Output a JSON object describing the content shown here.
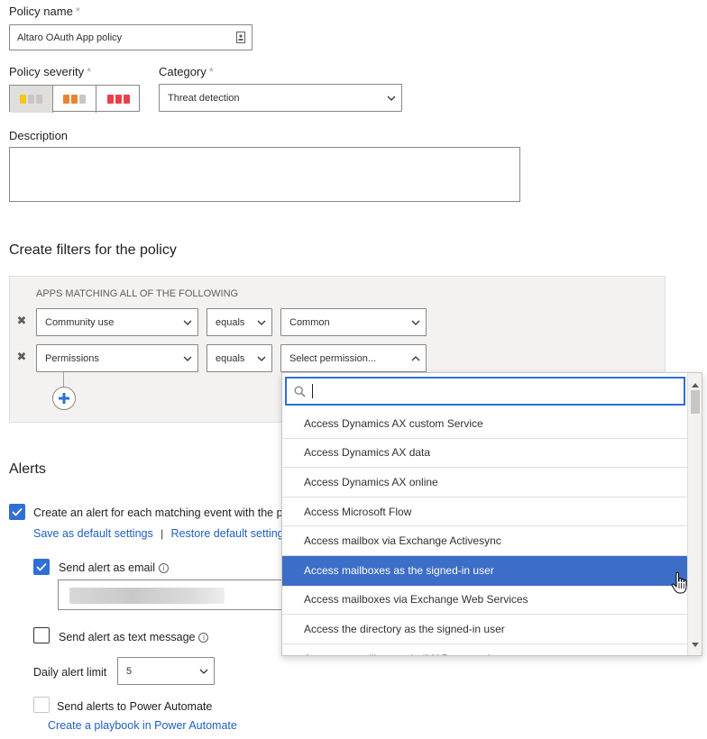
{
  "policy_name": {
    "label": "Policy name",
    "required": "*",
    "value": "Altaro OAuth App policy"
  },
  "policy_severity": {
    "label": "Policy severity",
    "required": "*",
    "options": [
      "low",
      "medium",
      "high"
    ],
    "colors": {
      "low": "#f2c811",
      "medium": "#e8862f",
      "high": "#e8414a"
    }
  },
  "category": {
    "label": "Category",
    "required": "*",
    "value": "Threat detection"
  },
  "description": {
    "label": "Description",
    "value": ""
  },
  "filters": {
    "title": "Create filters for the policy",
    "header": "APPS MATCHING ALL OF THE FOLLOWING",
    "rows": [
      {
        "field": "Community use",
        "operator": "equals",
        "value": "Common"
      },
      {
        "field": "Permissions",
        "operator": "equals",
        "value": "Select permission..."
      }
    ]
  },
  "alerts": {
    "title": "Alerts",
    "create_alert_label": "Create an alert for each matching event with the p",
    "save_default": "Save as default settings",
    "separator": "|",
    "restore_default": "Restore default setting",
    "send_email_label": "Send alert as email",
    "send_text_label": "Send alert as text message",
    "daily_limit_label": "Daily alert limit",
    "daily_limit_value": "5",
    "power_automate_label": "Send alerts to Power Automate",
    "playbook_link": "Create a playbook in Power Automate"
  },
  "permission_dropdown": {
    "search_value": "",
    "items": [
      "Access Dynamics AX custom Service",
      "Access Dynamics AX data",
      "Access Dynamics AX online",
      "Access Microsoft Flow",
      "Access mailbox via Exchange Activesync",
      "Access mailboxes as the signed-in user",
      "Access mailboxes via Exchange Web Services",
      "Access the directory as the signed-in user",
      "Access to mailboxes via IMAP protocol"
    ],
    "selected_index": 5
  },
  "colors": {
    "accent": "#2f6fd6",
    "selected_row": "#3c6ec7",
    "link": "#1f5fbf"
  }
}
